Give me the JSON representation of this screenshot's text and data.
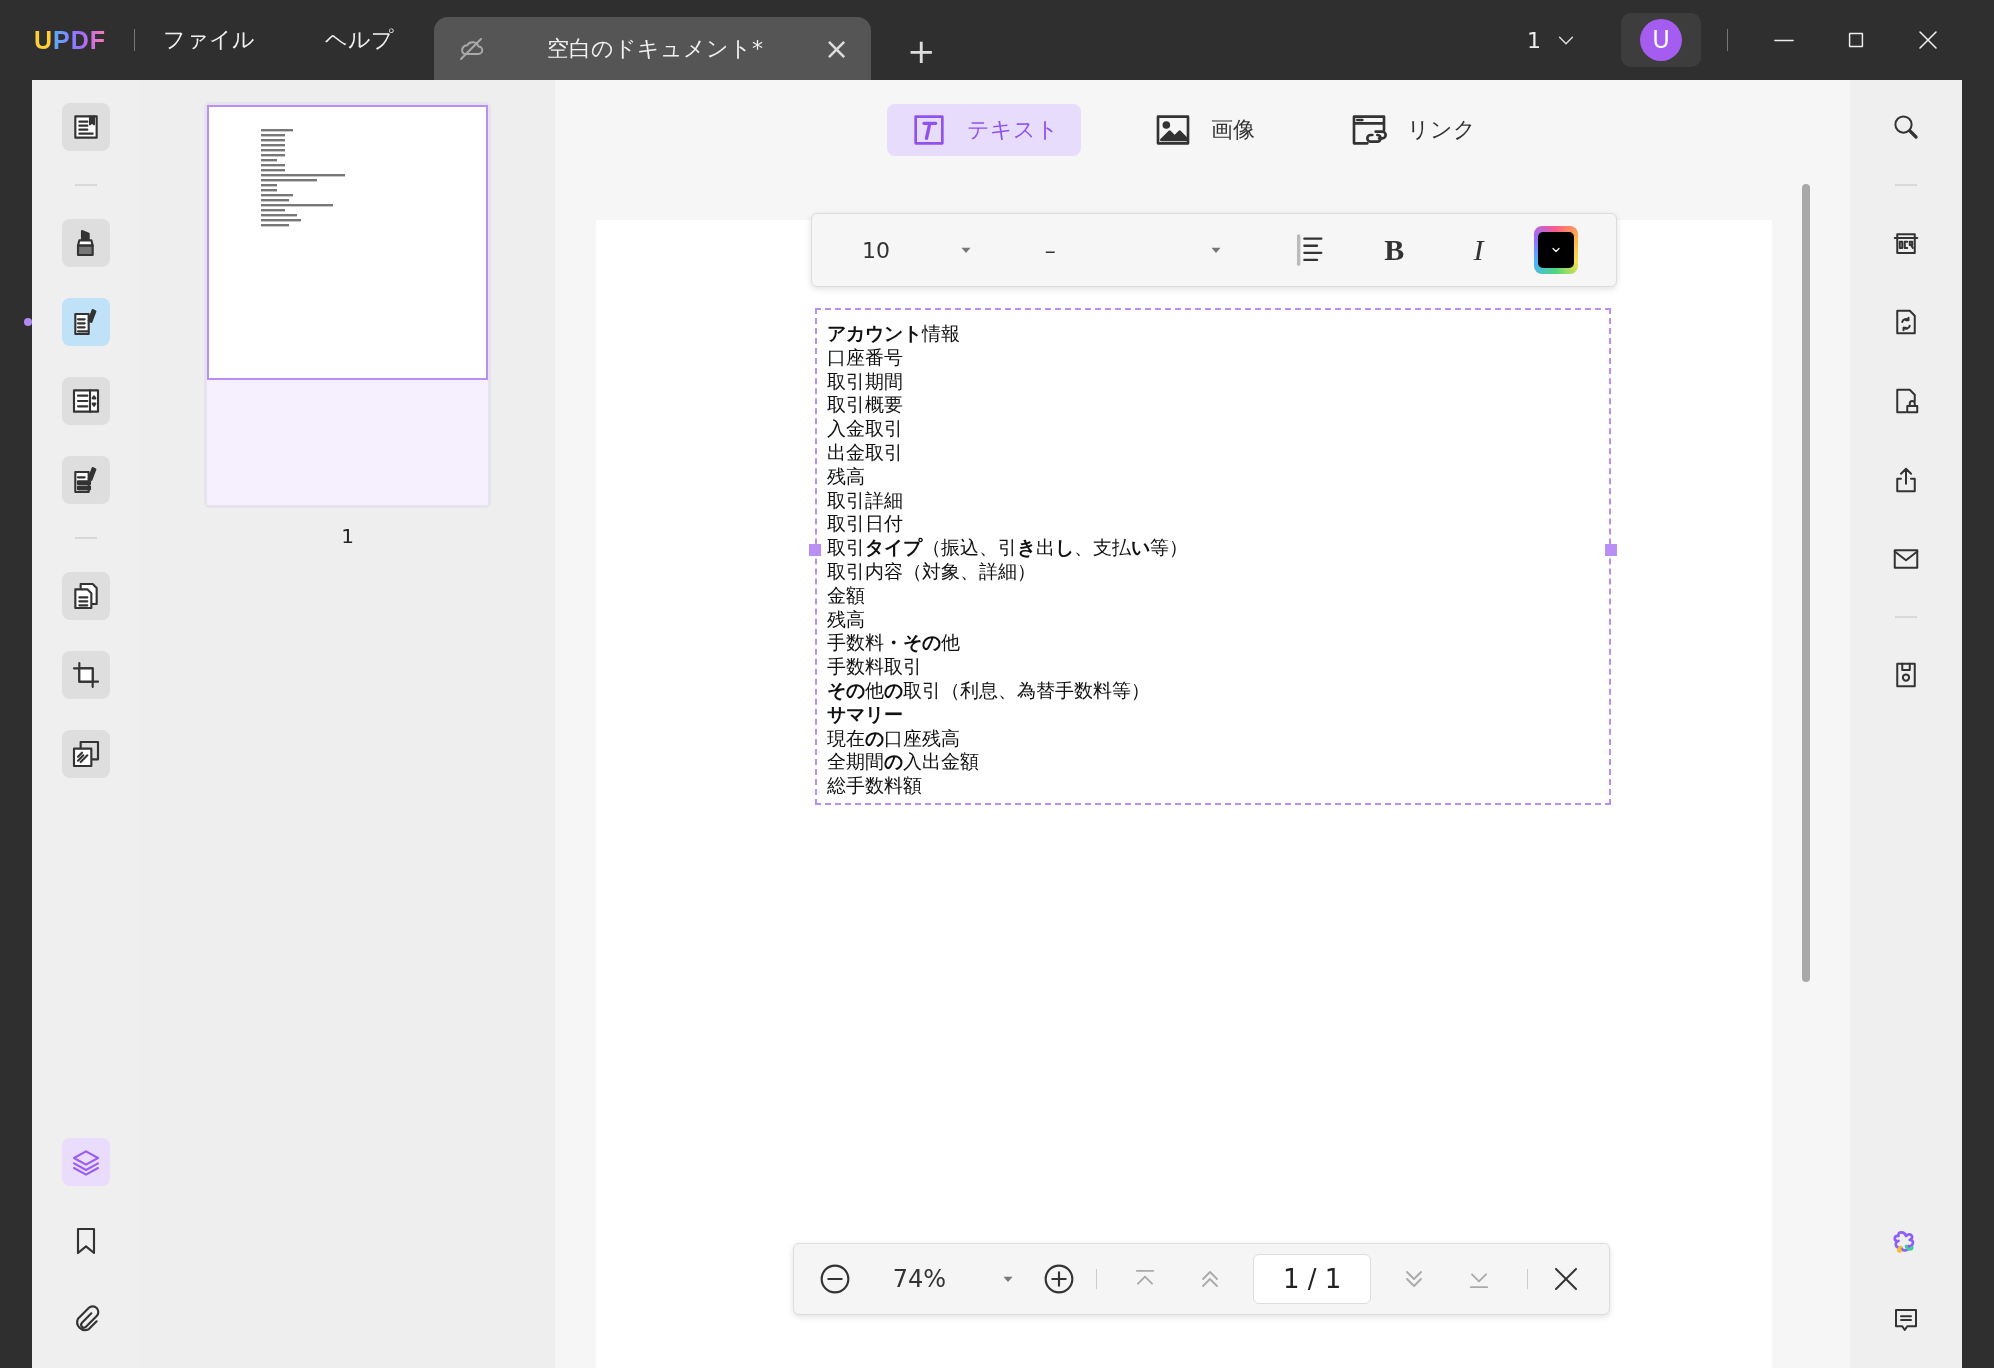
{
  "app": {
    "logo": "UPDF"
  },
  "menu": [
    {
      "label": "ファイル"
    },
    {
      "label": "ヘルプ"
    }
  ],
  "tabs": [
    {
      "title": "空白のドキュメント*",
      "selected": true,
      "close": "×"
    }
  ],
  "new_tab": {
    "label": "+"
  },
  "page_selector": {
    "value": "1"
  },
  "user": {
    "initial": "U"
  },
  "left_tools": [
    {
      "kind": "reader",
      "selected": false
    },
    {
      "kind": "separator"
    },
    {
      "kind": "comment",
      "selected": false
    },
    {
      "kind": "edit",
      "selected": true
    },
    {
      "kind": "form",
      "selected": false
    },
    {
      "kind": "redact",
      "selected": false
    },
    {
      "kind": "separator"
    },
    {
      "kind": "organize",
      "selected": false
    },
    {
      "kind": "crop",
      "selected": false
    },
    {
      "kind": "overlay",
      "selected": false
    }
  ],
  "left_tools_bottom": [
    {
      "kind": "layers",
      "selected": true
    },
    {
      "kind": "bookmark",
      "selected": false
    },
    {
      "kind": "attachment",
      "selected": false
    }
  ],
  "thumbnails": [
    {
      "label": "1",
      "selected": true
    }
  ],
  "edit_modes": [
    {
      "kind": "text",
      "label": "テキスト",
      "selected": true
    },
    {
      "kind": "image",
      "label": "画像",
      "selected": false
    },
    {
      "kind": "link",
      "label": "リンク",
      "selected": false
    }
  ],
  "format_bar": {
    "font_size": "10",
    "font_name": "–",
    "bold_label": "B",
    "italic_label": "I"
  },
  "text_box": {
    "lines": [
      "**アカウント**情報",
      "口座番号",
      "取引期間",
      "取引概要",
      "入金取引",
      "出金取引",
      "残高",
      "取引詳細",
      "取引日付",
      "取引**タイプ**（振込、引**き**出**し**、支払**い**等）",
      "取引内容（対象、詳細）",
      "金額",
      "残高",
      "手数料**・その**他",
      "手数料取引",
      "**その**他**の**取引（利息、為替手数料等）",
      "**サマリー**",
      "現在**の**口座残高",
      "全期間**の**入出金額",
      "総手数料額"
    ]
  },
  "zoom_bar": {
    "zoom": "74%",
    "page": "1 / 1",
    "nav": [
      {
        "kind": "first",
        "disabled": true
      },
      {
        "kind": "previous",
        "disabled": true
      },
      {
        "kind": "page"
      },
      {
        "kind": "next",
        "disabled": true
      },
      {
        "kind": "last",
        "disabled": true
      }
    ]
  },
  "right_tools": [
    {
      "kind": "search"
    },
    {
      "kind": "separator"
    },
    {
      "kind": "ocr"
    },
    {
      "kind": "convert"
    },
    {
      "kind": "protect"
    },
    {
      "kind": "share"
    },
    {
      "kind": "email"
    },
    {
      "kind": "separator"
    },
    {
      "kind": "save"
    }
  ],
  "right_tools_bottom": [
    {
      "kind": "ai"
    },
    {
      "kind": "comments"
    }
  ]
}
